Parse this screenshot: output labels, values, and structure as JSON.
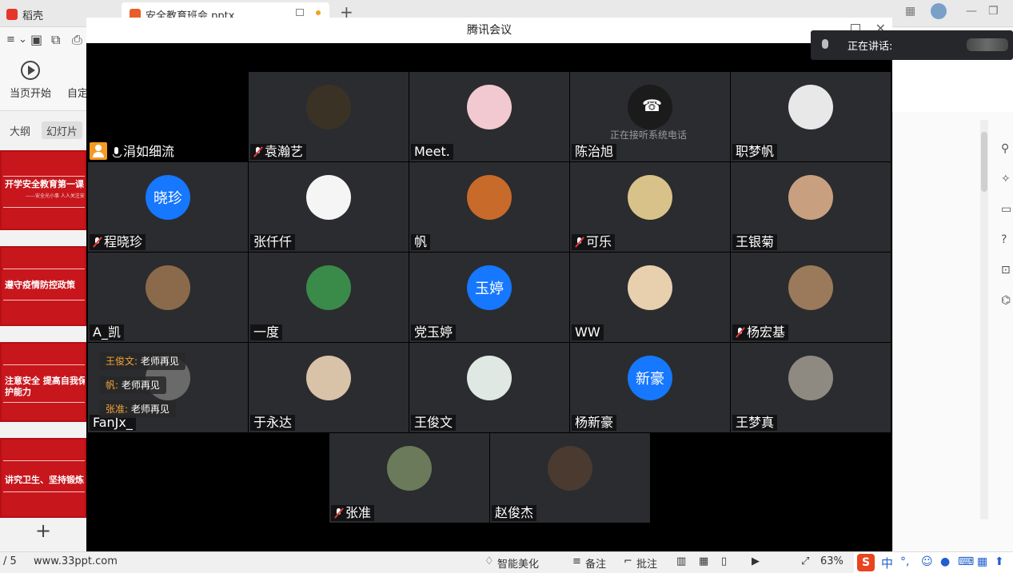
{
  "app": {
    "tabs": [
      {
        "label": "稻壳"
      },
      {
        "label": "安全教育班会.pptx"
      }
    ],
    "toolbar": {
      "play_from_current": "当页开始",
      "custom": "自定"
    },
    "panel_tabs": [
      "大纲",
      "幻灯片"
    ],
    "slides": [
      {
        "title": "开学安全教育第一课",
        "subtitle": "——安全光小事  人人关注安"
      },
      {
        "title": "遵守疫情防控政策"
      },
      {
        "title": "注意安全  提高自我保护能力"
      },
      {
        "title": "讲究卫生、坚持锻炼"
      }
    ],
    "status": {
      "page": "/ 5",
      "site": "www.33ppt.com",
      "beautify": "智能美化",
      "notes": "备注",
      "comments": "批注",
      "zoom": "63%"
    },
    "ime": {
      "logo": "S",
      "lang": "中"
    }
  },
  "meeting": {
    "title": "腾讯会议",
    "speaking_label": "正在讲话:",
    "phone_note": "正在接听系统电话",
    "participants": [
      {
        "name": "涓如细流",
        "mic": "on",
        "host": true,
        "avatar": "none"
      },
      {
        "name": "袁瀚艺",
        "mic": "off",
        "avatar": "photo",
        "color": "#3b3226"
      },
      {
        "name": "Meet.",
        "mic": "none",
        "avatar": "photo",
        "color": "#f2c9d0"
      },
      {
        "name": "陈治旭",
        "mic": "none",
        "avatar": "phone"
      },
      {
        "name": "职梦帆",
        "mic": "none",
        "avatar": "photo",
        "color": "#e8e8e8"
      },
      {
        "name": "程晓珍",
        "mic": "off",
        "avatar": "text",
        "avatar_text": "晓珍"
      },
      {
        "name": "张仟仟",
        "mic": "none",
        "avatar": "photo",
        "color": "#f5f5f5"
      },
      {
        "name": "帆",
        "mic": "none",
        "avatar": "photo",
        "color": "#c86a2a"
      },
      {
        "name": "可乐",
        "mic": "off",
        "avatar": "photo",
        "color": "#d9c28a"
      },
      {
        "name": "王银菊",
        "mic": "none",
        "avatar": "photo",
        "color": "#c9a07f"
      },
      {
        "name": "A_凯",
        "mic": "none",
        "avatar": "photo",
        "color": "#8a6a4a"
      },
      {
        "name": "一度",
        "mic": "none",
        "avatar": "photo",
        "color": "#3a8a4a"
      },
      {
        "name": "党玉婷",
        "mic": "none",
        "avatar": "text",
        "avatar_text": "玉婷"
      },
      {
        "name": "WW",
        "mic": "none",
        "avatar": "photo",
        "color": "#e8cfae"
      },
      {
        "name": "杨宏基",
        "mic": "off",
        "avatar": "photo",
        "color": "#9a7a5a"
      },
      {
        "name": "FanJx_",
        "mic": "none",
        "avatar": "photo",
        "color": "#6a6a6a"
      },
      {
        "name": "于永达",
        "mic": "none",
        "avatar": "photo",
        "color": "#d8c2a8"
      },
      {
        "name": "王俊文",
        "mic": "none",
        "avatar": "photo",
        "color": "#dfe8e2"
      },
      {
        "name": "杨新豪",
        "mic": "none",
        "avatar": "text",
        "avatar_text": "新豪"
      },
      {
        "name": "王梦真",
        "mic": "none",
        "avatar": "photo",
        "color": "#8e8a82"
      },
      {
        "name": "张准",
        "mic": "off",
        "avatar": "photo",
        "color": "#6a7a5a"
      },
      {
        "name": "赵俊杰",
        "mic": "none",
        "avatar": "photo",
        "color": "#4a3a30"
      }
    ],
    "chat": [
      {
        "who": "王俊文:",
        "text": "老师再见"
      },
      {
        "who": "帆:",
        "text": "老师再见"
      },
      {
        "who": "张准:",
        "text": "老师再见"
      }
    ]
  }
}
